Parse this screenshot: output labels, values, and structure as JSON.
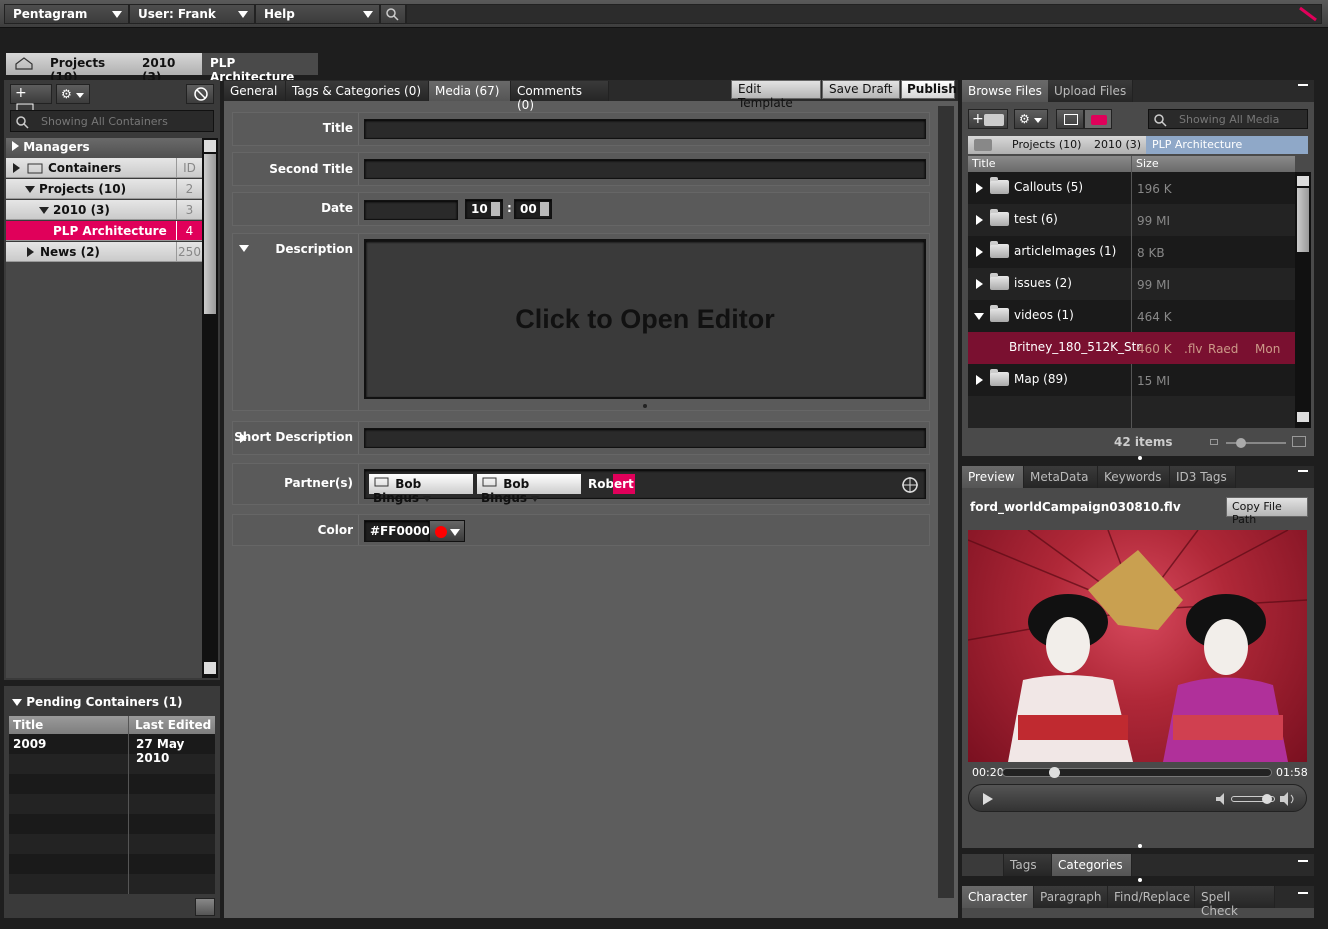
{
  "menubar": {
    "app": "Pentagram",
    "user": "User: Frank",
    "help": "Help"
  },
  "breadcrumb": {
    "projects": "Projects (10)",
    "year": "2010 (3)",
    "current": "PLP Architecture"
  },
  "left": {
    "search_placeholder": "Showing All Containers",
    "tree": {
      "managers": "Managers",
      "containers": "Containers",
      "containers_id": "ID",
      "projects": "Projects (10)",
      "projects_id": "2",
      "year": "2010 (3)",
      "year_id": "3",
      "plp": "PLP Architecture",
      "plp_id": "4",
      "news": "News (2)",
      "news_id": "250"
    },
    "pending": {
      "title": "Pending Containers (1)",
      "col_title": "Title",
      "col_edited": "Last Edited",
      "rows": [
        {
          "title": "2009",
          "edited": "27 May 2010"
        }
      ]
    }
  },
  "center": {
    "tabs": {
      "general": "General",
      "tags": "Tags & Categories (0)",
      "media": "Media (67)",
      "comments": "Comments (0)"
    },
    "actions": {
      "edit": "Edit Template",
      "save": "Save Draft",
      "publish": "Publish"
    },
    "fields": {
      "title": "Title",
      "second_title": "Second Title",
      "date": "Date",
      "hour": "10",
      "minute": "00",
      "time_sep": ":",
      "description": "Description",
      "editor_prompt": "Click to Open Editor",
      "short_description": "Short Description",
      "partners": "Partner(s)",
      "partner1": "Bob Bingus",
      "partner2": "Bob Bingus",
      "partner_typed": "Rob",
      "partner_suggest": "ert",
      "color": "Color",
      "color_value": "#FF0000"
    }
  },
  "right": {
    "file_tabs": {
      "browse": "Browse Files",
      "upload": "Upload Files"
    },
    "search_placeholder": "Showing All Media",
    "crumbs": {
      "projects": "Projects (10)",
      "year": "2010 (3)",
      "current": "PLP Architecture"
    },
    "cols": {
      "title": "Title",
      "size": "Size"
    },
    "files": [
      {
        "name": "Callouts (5)",
        "size": "196 K"
      },
      {
        "name": "test (6)",
        "size": "99 MI"
      },
      {
        "name": "articleImages (1)",
        "size": "8 KB"
      },
      {
        "name": "issues (2)",
        "size": "99 MI"
      },
      {
        "name": "videos (1)",
        "size": "464 K"
      },
      {
        "name": "Britney_180_512K_Str",
        "size": "460 K",
        "ext": ".flv",
        "author": "Raed",
        "day": "Mon"
      },
      {
        "name": "Map (89)",
        "size": "15 MI"
      }
    ],
    "item_count": "42 items",
    "preview_tabs": {
      "preview": "Preview",
      "metadata": "MetaData",
      "keywords": "Keywords",
      "id3": "ID3 Tags"
    },
    "filename": "ford_worldCampaign030810.flv",
    "copy_path": "Copy File Path",
    "time_current": "00:20",
    "time_total": "01:58",
    "playback_fraction": 0.17,
    "tag_tabs": {
      "tags": "Tags",
      "categories": "Categories"
    },
    "text_tabs": {
      "character": "Character",
      "paragraph": "Paragraph",
      "find": "Find/Replace",
      "spell": "Spell Check"
    }
  },
  "colors": {
    "accent": "#e0005a",
    "highlight_row": "#7a1030",
    "swatch": "#FF0000"
  }
}
